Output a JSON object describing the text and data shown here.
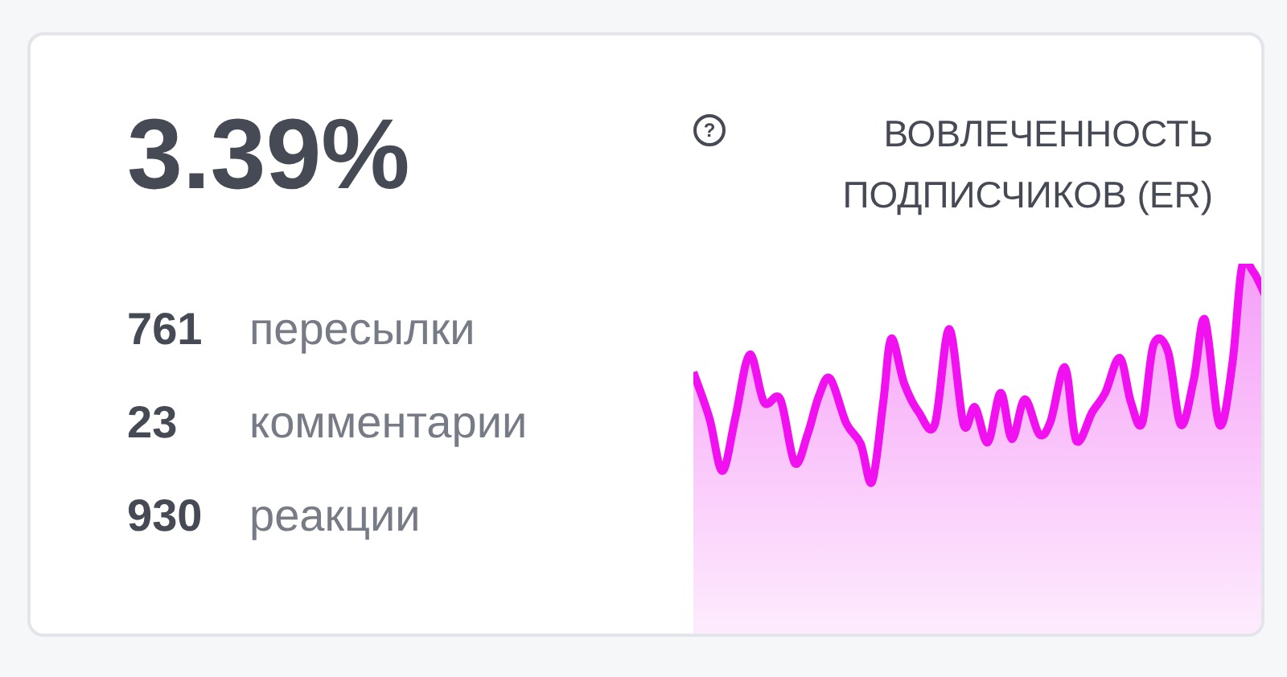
{
  "metric": {
    "value": "3.39%",
    "title": "ВОВЛЕЧЕННОСТЬ ПОДПИСЧИКОВ (ER)",
    "help_icon": "?"
  },
  "stats": [
    {
      "value": "761",
      "label": "пересылки"
    },
    {
      "value": "23",
      "label": "комментарии"
    },
    {
      "value": "930",
      "label": "реакции"
    }
  ]
}
